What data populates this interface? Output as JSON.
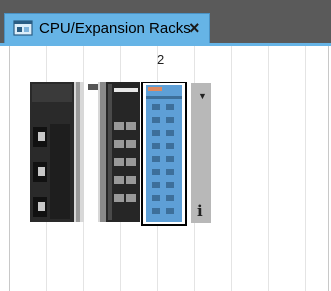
{
  "tab": {
    "title": "CPU/Expansion Racks",
    "close_symbol": "×",
    "icon": "rack-window-icon"
  },
  "rack": {
    "slot_label": "2",
    "selected_slot": "2",
    "dropdown_symbol": "▼",
    "info_symbol": "i"
  },
  "colors": {
    "tab_active": "#66b4e6",
    "tab_strip": "#5a5a5a",
    "selected_unit": "#5e9fd6",
    "selection_outline": "#000000"
  }
}
